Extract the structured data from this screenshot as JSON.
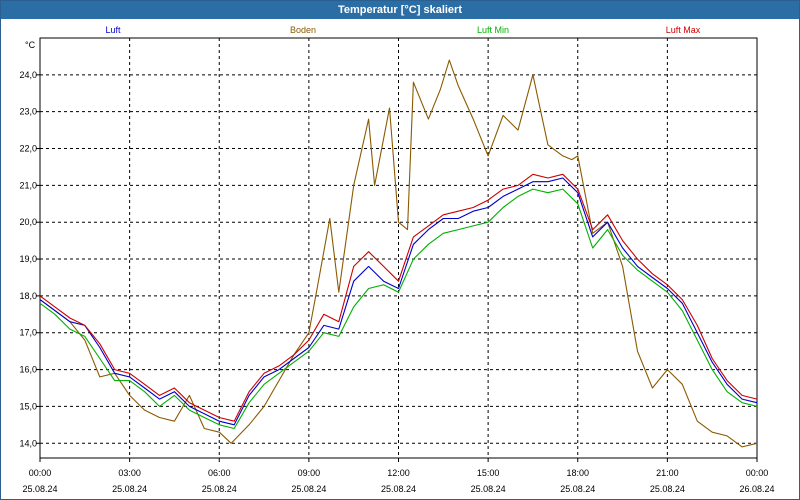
{
  "window": {
    "title": "Temperatur [°C] skaliert"
  },
  "colors": {
    "titlebar": "#2b6ea6",
    "grid": "#000000"
  },
  "chart_data": {
    "type": "line",
    "ylabel": "°C",
    "ylim": [
      13.6,
      25.0
    ],
    "grid": true,
    "legend_position": "top",
    "y_ticks": [
      "24,0",
      "23,0",
      "22,0",
      "21,0",
      "20,0",
      "19,0",
      "18,0",
      "17,0",
      "16,0",
      "15,0",
      "14,0"
    ],
    "y_tick_values": [
      24,
      23,
      22,
      21,
      20,
      19,
      18,
      17,
      16,
      15,
      14
    ],
    "x_range_hours": [
      0,
      24
    ],
    "x_ticks": [
      {
        "time": "00:00",
        "date": "25.08.24"
      },
      {
        "time": "03:00",
        "date": "25.08.24"
      },
      {
        "time": "06:00",
        "date": "25.08.24"
      },
      {
        "time": "09:00",
        "date": "25.08.24"
      },
      {
        "time": "12:00",
        "date": "25.08.24"
      },
      {
        "time": "15:00",
        "date": "25.08.24"
      },
      {
        "time": "18:00",
        "date": "25.08.24"
      },
      {
        "time": "21:00",
        "date": "25.08.24"
      },
      {
        "time": "00:00",
        "date": "26.08.24"
      }
    ],
    "series": [
      {
        "name": "Luft",
        "color": "#0000cc",
        "points": [
          [
            0,
            17.9
          ],
          [
            0.5,
            17.6
          ],
          [
            1,
            17.3
          ],
          [
            1.5,
            17.2
          ],
          [
            2,
            16.6
          ],
          [
            2.5,
            15.9
          ],
          [
            3,
            15.8
          ],
          [
            3.5,
            15.5
          ],
          [
            4,
            15.2
          ],
          [
            4.5,
            15.4
          ],
          [
            5,
            15.0
          ],
          [
            5.5,
            14.8
          ],
          [
            6,
            14.6
          ],
          [
            6.5,
            14.5
          ],
          [
            7,
            15.3
          ],
          [
            7.5,
            15.8
          ],
          [
            8,
            16.0
          ],
          [
            8.5,
            16.3
          ],
          [
            9,
            16.6
          ],
          [
            9.5,
            17.2
          ],
          [
            10,
            17.1
          ],
          [
            10.5,
            18.4
          ],
          [
            11,
            18.8
          ],
          [
            11.5,
            18.4
          ],
          [
            12,
            18.2
          ],
          [
            12.5,
            19.4
          ],
          [
            13,
            19.8
          ],
          [
            13.5,
            20.1
          ],
          [
            14,
            20.1
          ],
          [
            14.5,
            20.3
          ],
          [
            15,
            20.4
          ],
          [
            15.5,
            20.7
          ],
          [
            16,
            20.9
          ],
          [
            16.5,
            21.1
          ],
          [
            17,
            21.1
          ],
          [
            17.5,
            21.2
          ],
          [
            18,
            20.8
          ],
          [
            18.5,
            19.6
          ],
          [
            19,
            20.0
          ],
          [
            19.5,
            19.3
          ],
          [
            20,
            18.8
          ],
          [
            20.5,
            18.5
          ],
          [
            21,
            18.2
          ],
          [
            21.5,
            17.8
          ],
          [
            22,
            17.0
          ],
          [
            22.5,
            16.2
          ],
          [
            23,
            15.6
          ],
          [
            23.5,
            15.2
          ],
          [
            24,
            15.1
          ]
        ]
      },
      {
        "name": "Boden",
        "color": "#8b5a00",
        "points": [
          [
            0,
            17.9
          ],
          [
            0.5,
            17.6
          ],
          [
            1,
            17.3
          ],
          [
            1.5,
            16.8
          ],
          [
            2,
            15.8
          ],
          [
            2.5,
            15.9
          ],
          [
            3,
            15.3
          ],
          [
            3.5,
            14.9
          ],
          [
            4,
            14.7
          ],
          [
            4.5,
            14.6
          ],
          [
            5,
            15.3
          ],
          [
            5.5,
            14.4
          ],
          [
            6,
            14.3
          ],
          [
            6.4,
            14.0
          ],
          [
            7,
            14.5
          ],
          [
            7.5,
            15.0
          ],
          [
            8,
            15.7
          ],
          [
            8.5,
            16.4
          ],
          [
            9,
            17.0
          ],
          [
            9.3,
            18.3
          ],
          [
            9.7,
            20.1
          ],
          [
            10,
            18.1
          ],
          [
            10.5,
            21.0
          ],
          [
            11,
            22.8
          ],
          [
            11.2,
            21.0
          ],
          [
            11.7,
            23.1
          ],
          [
            12.0,
            20.0
          ],
          [
            12.3,
            19.8
          ],
          [
            12.5,
            23.8
          ],
          [
            13,
            22.8
          ],
          [
            13.4,
            23.6
          ],
          [
            13.7,
            24.4
          ],
          [
            14,
            23.7
          ],
          [
            14.5,
            22.8
          ],
          [
            15,
            21.8
          ],
          [
            15.5,
            22.9
          ],
          [
            16,
            22.5
          ],
          [
            16.5,
            24.0
          ],
          [
            17,
            22.1
          ],
          [
            17.5,
            21.8
          ],
          [
            17.8,
            21.7
          ],
          [
            18,
            21.8
          ],
          [
            18.5,
            19.7
          ],
          [
            19,
            20.0
          ],
          [
            19.5,
            18.8
          ],
          [
            20,
            16.5
          ],
          [
            20.5,
            15.5
          ],
          [
            21,
            16.0
          ],
          [
            21.5,
            15.6
          ],
          [
            22,
            14.6
          ],
          [
            22.5,
            14.3
          ],
          [
            23,
            14.2
          ],
          [
            23.5,
            13.9
          ],
          [
            24,
            14.0
          ]
        ]
      },
      {
        "name": "Luft Min",
        "color": "#00b000",
        "points": [
          [
            0,
            17.8
          ],
          [
            0.5,
            17.5
          ],
          [
            1,
            17.1
          ],
          [
            1.5,
            16.9
          ],
          [
            2,
            16.3
          ],
          [
            2.5,
            15.7
          ],
          [
            3,
            15.7
          ],
          [
            3.5,
            15.4
          ],
          [
            4,
            15.0
          ],
          [
            4.5,
            15.3
          ],
          [
            5,
            14.9
          ],
          [
            5.5,
            14.7
          ],
          [
            6,
            14.5
          ],
          [
            6.5,
            14.4
          ],
          [
            7,
            15.1
          ],
          [
            7.5,
            15.6
          ],
          [
            8,
            15.9
          ],
          [
            8.5,
            16.2
          ],
          [
            9,
            16.5
          ],
          [
            9.5,
            17.0
          ],
          [
            10,
            16.9
          ],
          [
            10.5,
            17.7
          ],
          [
            11,
            18.2
          ],
          [
            11.5,
            18.3
          ],
          [
            12,
            18.1
          ],
          [
            12.5,
            19.0
          ],
          [
            13,
            19.4
          ],
          [
            13.5,
            19.7
          ],
          [
            14,
            19.8
          ],
          [
            14.5,
            19.9
          ],
          [
            15,
            20.0
          ],
          [
            15.5,
            20.4
          ],
          [
            16,
            20.7
          ],
          [
            16.5,
            20.9
          ],
          [
            17,
            20.8
          ],
          [
            17.5,
            20.9
          ],
          [
            18,
            20.5
          ],
          [
            18.5,
            19.3
          ],
          [
            19,
            19.8
          ],
          [
            19.5,
            19.1
          ],
          [
            20,
            18.7
          ],
          [
            20.5,
            18.4
          ],
          [
            21,
            18.1
          ],
          [
            21.5,
            17.6
          ],
          [
            22,
            16.8
          ],
          [
            22.5,
            16.0
          ],
          [
            23,
            15.4
          ],
          [
            23.5,
            15.1
          ],
          [
            24,
            15.0
          ]
        ]
      },
      {
        "name": "Luft Max",
        "color": "#cc0000",
        "points": [
          [
            0,
            18.0
          ],
          [
            0.5,
            17.7
          ],
          [
            1,
            17.4
          ],
          [
            1.5,
            17.2
          ],
          [
            2,
            16.7
          ],
          [
            2.5,
            16.0
          ],
          [
            3,
            15.9
          ],
          [
            3.5,
            15.6
          ],
          [
            4,
            15.3
          ],
          [
            4.5,
            15.5
          ],
          [
            5,
            15.1
          ],
          [
            5.5,
            14.9
          ],
          [
            6,
            14.7
          ],
          [
            6.5,
            14.6
          ],
          [
            7,
            15.4
          ],
          [
            7.5,
            15.9
          ],
          [
            8,
            16.1
          ],
          [
            8.5,
            16.4
          ],
          [
            9,
            16.8
          ],
          [
            9.5,
            17.5
          ],
          [
            10,
            17.3
          ],
          [
            10.5,
            18.8
          ],
          [
            11,
            19.2
          ],
          [
            11.5,
            18.8
          ],
          [
            12,
            18.4
          ],
          [
            12.5,
            19.6
          ],
          [
            13,
            19.9
          ],
          [
            13.5,
            20.2
          ],
          [
            14,
            20.3
          ],
          [
            14.5,
            20.4
          ],
          [
            15,
            20.6
          ],
          [
            15.5,
            20.9
          ],
          [
            16,
            21.0
          ],
          [
            16.5,
            21.3
          ],
          [
            17,
            21.2
          ],
          [
            17.5,
            21.3
          ],
          [
            18,
            20.9
          ],
          [
            18.5,
            19.8
          ],
          [
            19,
            20.2
          ],
          [
            19.5,
            19.5
          ],
          [
            20,
            19.0
          ],
          [
            20.5,
            18.6
          ],
          [
            21,
            18.3
          ],
          [
            21.5,
            17.9
          ],
          [
            22,
            17.2
          ],
          [
            22.5,
            16.3
          ],
          [
            23,
            15.7
          ],
          [
            23.5,
            15.3
          ],
          [
            24,
            15.2
          ]
        ]
      }
    ]
  }
}
